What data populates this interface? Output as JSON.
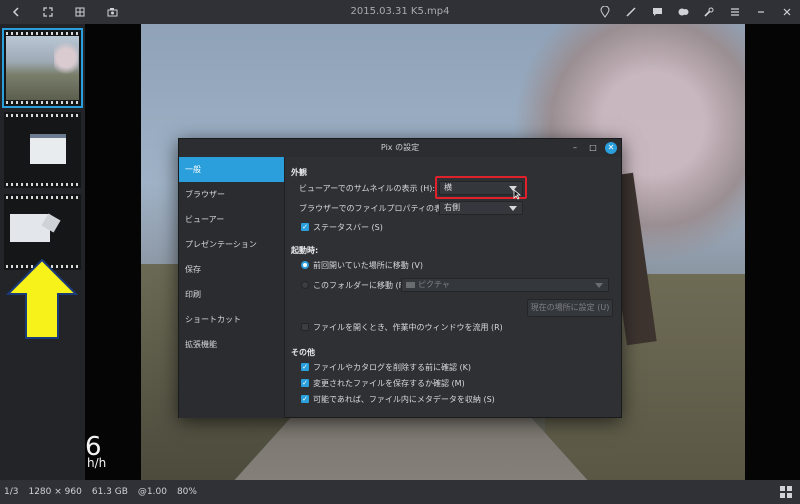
{
  "window": {
    "title": "2015.03.31 K5.mp4"
  },
  "header": {
    "left_icons": [
      "back-icon",
      "fullscreen-icon",
      "grid-icon",
      "camera-icon"
    ],
    "right_icons": [
      "location-icon",
      "brush-icon",
      "comment-icon",
      "tag-icon",
      "wrench-icon",
      "menu-icon",
      "minimize-icon",
      "close-icon"
    ]
  },
  "viewer": {
    "speed_value": "6",
    "speed_unit": "h/h"
  },
  "dialog": {
    "title": "Pix の設定",
    "sidebar": [
      {
        "label": "一般",
        "active": true
      },
      {
        "label": "ブラウザー",
        "active": false
      },
      {
        "label": "ビューアー",
        "active": false
      },
      {
        "label": "プレゼンテーション",
        "active": false
      },
      {
        "label": "保存",
        "active": false
      },
      {
        "label": "印刷",
        "active": false
      },
      {
        "label": "ショートカット",
        "active": false
      },
      {
        "label": "拡張機能",
        "active": false
      }
    ],
    "appearance": {
      "heading": "外観",
      "viewer_thumbnail_label": "ビューアーでのサムネイルの表示 (H):",
      "viewer_thumbnail_value": "横",
      "browser_file_props_label": "ブラウザーでのファイルプロパティの表示 (P):",
      "browser_file_props_value": "右側",
      "statusbar_label": "ステータスバー (S)",
      "statusbar_checked": true
    },
    "startup": {
      "heading": "起動時:",
      "last_location_label": "前回開いていた場所に移動 (V)",
      "folder_label": "このフォルダーに移動 (F):",
      "folder_value": "ピクチャ",
      "set_current_button": "現在の場所に設定 (U)",
      "reuse_window_label": "ファイルを開くとき、作業中のウィンドウを流用 (R)",
      "reuse_window_checked": false
    },
    "other": {
      "heading": "その他",
      "confirm_delete_label": "ファイルやカタログを削除する前に確認 (K)",
      "confirm_save_label": "変更されたファイルを保存するか確認 (M)",
      "store_metadata_label": "可能であれば、ファイル内にメタデータを収納 (S)"
    }
  },
  "status": {
    "position": "1/3",
    "dimensions": "1280 × 960",
    "size": "61.3 GB",
    "zoom_factor": "@1.00",
    "zoom_percent": "80%"
  },
  "colors": {
    "accent": "#2a9fdc",
    "highlight_box": "#e0202a",
    "arrow": "#f7f21a"
  }
}
